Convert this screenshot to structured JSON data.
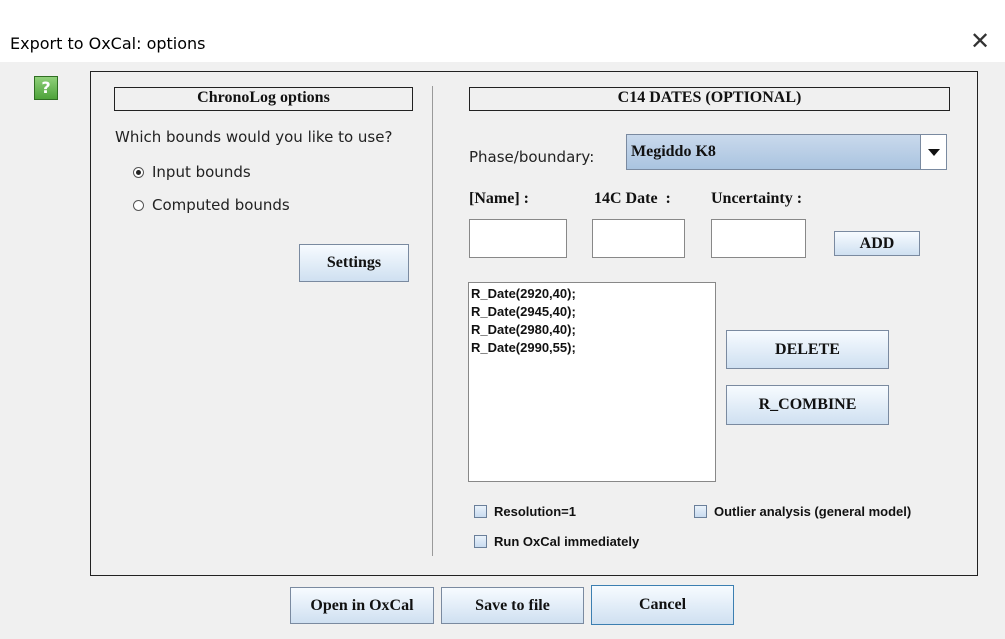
{
  "window": {
    "title": "Export to OxCal: options",
    "close_symbol": "✕"
  },
  "help": {
    "symbol": "?"
  },
  "left": {
    "header": "ChronoLog options",
    "question": "Which bounds would you like to use?",
    "radios": [
      {
        "label": "Input bounds",
        "selected": true
      },
      {
        "label": "Computed bounds",
        "selected": false
      }
    ],
    "settings_label": "Settings"
  },
  "right": {
    "header": "C14 DATES (OPTIONAL)",
    "phase_label": "Phase/boundary:",
    "phase_value": "Megiddo K8",
    "name_label": "[Name] :",
    "date_label": "14C Date  :",
    "uncertainty_label": "Uncertainty :",
    "name_value": "",
    "date_value": "",
    "uncertainty_value": "",
    "add_label": "ADD",
    "dates": [
      "R_Date(2920,40);",
      "R_Date(2945,40);",
      "R_Date(2980,40);",
      "R_Date(2990,55);"
    ],
    "delete_label": "DELETE",
    "combine_label": "R_COMBINE",
    "checkboxes": {
      "resolution": {
        "label": "Resolution=1",
        "checked": false
      },
      "outlier": {
        "label": "Outlier analysis (general model)",
        "checked": false
      },
      "run": {
        "label": "Run OxCal immediately",
        "checked": false
      }
    }
  },
  "footer": {
    "open_label": "Open in OxCal",
    "save_label": "Save to file",
    "cancel_label": "Cancel"
  }
}
